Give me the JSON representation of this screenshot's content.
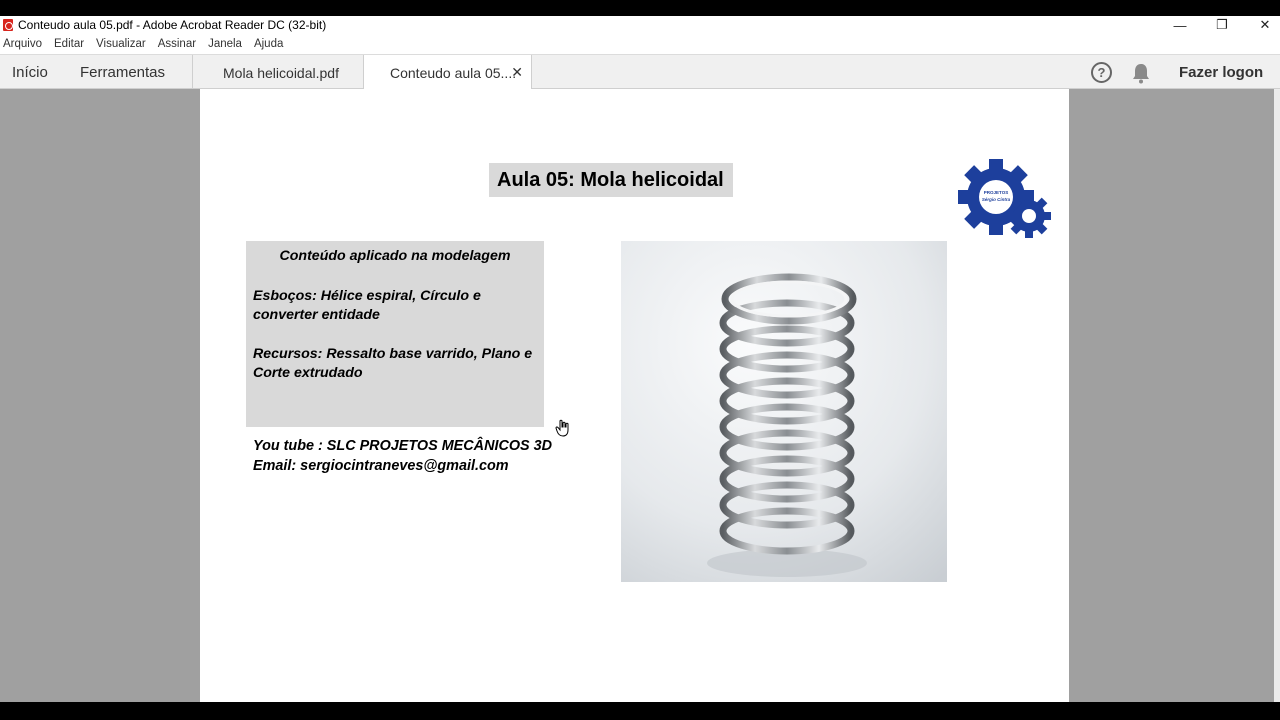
{
  "window": {
    "title": "Conteudo aula 05.pdf - Adobe Acrobat Reader DC (32-bit)",
    "controls": {
      "minimize": "—",
      "restore": "❐",
      "close": "✕"
    }
  },
  "menubar": [
    "Arquivo",
    "Editar",
    "Visualizar",
    "Assinar",
    "Janela",
    "Ajuda"
  ],
  "nav_tabs": {
    "home": "Início",
    "tools": "Ferramentas"
  },
  "doc_tabs": [
    {
      "label": "Mola helicoidal.pdf",
      "active": false
    },
    {
      "label": "Conteudo aula 05....",
      "active": true,
      "close": "✕"
    }
  ],
  "header_right": {
    "help": "?",
    "logon": "Fazer logon"
  },
  "pdf": {
    "title": "Aula 05: Mola helicoidal",
    "content_box": {
      "heading": "Conteúdo aplicado na modelagem",
      "sketches": "Esboços:  Hélice espiral, Círculo e converter entidade",
      "features": "Recursos: Ressalto base varrido, Plano e Corte extrudado"
    },
    "contact": {
      "youtube": "You tube : SLC PROJETOS MECÂNICOS 3D",
      "email": "Email: sergiocintraneves@gmail.com"
    },
    "logo_text": [
      "PROJETOS",
      "Sérgio Cintra"
    ]
  },
  "colors": {
    "logo_blue": "#1d3f9c",
    "gray_box": "#d9d9d9",
    "viewer_bg": "#a0a0a0"
  }
}
